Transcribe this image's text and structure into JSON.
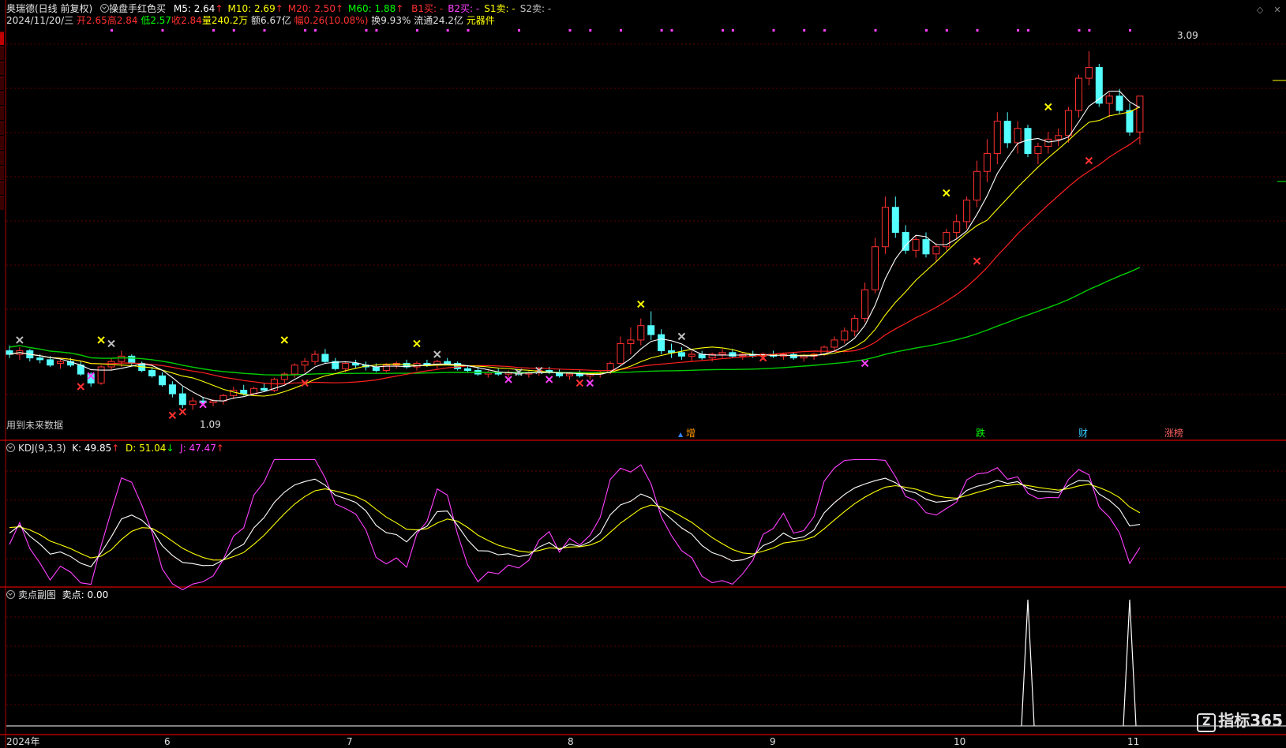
{
  "header": {
    "stock_name": "奥瑞德(日线 前复权)",
    "indicator_name": "操盘手红色买",
    "ma": [
      {
        "label": "M5:",
        "value": "2.64",
        "arrow": "↑",
        "color": "#ffffff"
      },
      {
        "label": "M10:",
        "value": "2.69",
        "arrow": "↑",
        "color": "#ffff00"
      },
      {
        "label": "M20:",
        "value": "2.50",
        "arrow": "↑",
        "color": "#ff3030"
      },
      {
        "label": "M60:",
        "value": "1.88",
        "arrow": "↑",
        "color": "#00ff00"
      }
    ],
    "signals": [
      {
        "label": "B1买:",
        "value": "-",
        "color": "#ff3030"
      },
      {
        "label": "B2买:",
        "value": "-",
        "color": "#ff40ff"
      },
      {
        "label": "S1卖:",
        "value": "-",
        "color": "#ffff00"
      },
      {
        "label": "S2卖:",
        "value": "-",
        "color": "#c0c0c0"
      }
    ],
    "date": "2024/11/20/三",
    "open": "开2.65",
    "high": "高2.84",
    "low": "低2.57",
    "close": "收2.84",
    "volume": "量240.2万",
    "amount": "额6.67亿",
    "change": "幅0.26(10.08%)",
    "turnover": "换9.93%",
    "float": "流通24.2亿",
    "sector": "元器件"
  },
  "main_panel": {
    "future_data_note": "用到未来数据",
    "high_label": "3.09",
    "low_label": "1.09",
    "events": [
      {
        "label": "增",
        "color": "#ff9900"
      },
      {
        "label": "跌",
        "color": "#00ff00"
      },
      {
        "label": "财",
        "color": "#33ccff"
      },
      {
        "label": "涨榜",
        "color": "#ff6060"
      }
    ]
  },
  "kdj_panel": {
    "title": "KDJ(9,3,3)",
    "k": "K: 49.85",
    "k_arrow": "↑",
    "d": "D: 51.04",
    "d_arrow": "↓",
    "j": "J: 47.47",
    "j_arrow": "↑"
  },
  "sell_panel": {
    "title": "卖点副图",
    "value": "卖点: 0.00"
  },
  "x_axis": {
    "labels": [
      "2024年",
      "6",
      "7",
      "8",
      "9",
      "10",
      "11"
    ]
  },
  "logo": {
    "text": "指标365",
    "mark": "Z"
  },
  "colors": {
    "up": "#ff3030",
    "down": "#54ffff",
    "ma5": "#ffffff",
    "ma10": "#ffff00",
    "ma20": "#ff2020",
    "ma60": "#00cc00",
    "grid": "#5a0000",
    "panel_border": "#b00000"
  },
  "chart_data": {
    "type": "candlestick",
    "candles": [
      [
        1.42,
        1.45,
        1.38,
        1.4
      ],
      [
        1.4,
        1.44,
        1.37,
        1.42
      ],
      [
        1.42,
        1.43,
        1.36,
        1.38
      ],
      [
        1.38,
        1.4,
        1.35,
        1.37
      ],
      [
        1.37,
        1.39,
        1.33,
        1.34
      ],
      [
        1.35,
        1.37,
        1.32,
        1.36
      ],
      [
        1.36,
        1.38,
        1.33,
        1.34
      ],
      [
        1.34,
        1.36,
        1.28,
        1.29
      ],
      [
        1.29,
        1.3,
        1.22,
        1.24
      ],
      [
        1.24,
        1.34,
        1.23,
        1.33
      ],
      [
        1.33,
        1.38,
        1.31,
        1.36
      ],
      [
        1.36,
        1.42,
        1.33,
        1.39
      ],
      [
        1.39,
        1.4,
        1.34,
        1.35
      ],
      [
        1.35,
        1.36,
        1.3,
        1.31
      ],
      [
        1.31,
        1.33,
        1.27,
        1.28
      ],
      [
        1.28,
        1.3,
        1.22,
        1.23
      ],
      [
        1.23,
        1.25,
        1.16,
        1.18
      ],
      [
        1.18,
        1.22,
        1.1,
        1.12
      ],
      [
        1.12,
        1.16,
        1.09,
        1.14
      ],
      [
        1.14,
        1.16,
        1.12,
        1.13
      ],
      [
        1.13,
        1.15,
        1.11,
        1.14
      ],
      [
        1.14,
        1.18,
        1.12,
        1.17
      ],
      [
        1.17,
        1.22,
        1.15,
        1.2
      ],
      [
        1.2,
        1.23,
        1.17,
        1.18
      ],
      [
        1.18,
        1.22,
        1.17,
        1.21
      ],
      [
        1.21,
        1.24,
        1.19,
        1.2
      ],
      [
        1.2,
        1.27,
        1.19,
        1.26
      ],
      [
        1.26,
        1.3,
        1.24,
        1.29
      ],
      [
        1.29,
        1.35,
        1.27,
        1.34
      ],
      [
        1.34,
        1.38,
        1.3,
        1.36
      ],
      [
        1.36,
        1.42,
        1.34,
        1.4
      ],
      [
        1.4,
        1.43,
        1.35,
        1.36
      ],
      [
        1.36,
        1.38,
        1.31,
        1.32
      ],
      [
        1.32,
        1.36,
        1.3,
        1.35
      ],
      [
        1.35,
        1.37,
        1.32,
        1.34
      ],
      [
        1.34,
        1.36,
        1.31,
        1.33
      ],
      [
        1.33,
        1.35,
        1.3,
        1.31
      ],
      [
        1.31,
        1.35,
        1.3,
        1.34
      ],
      [
        1.34,
        1.36,
        1.32,
        1.35
      ],
      [
        1.35,
        1.37,
        1.32,
        1.33
      ],
      [
        1.33,
        1.36,
        1.31,
        1.35
      ],
      [
        1.35,
        1.37,
        1.33,
        1.34
      ],
      [
        1.34,
        1.37,
        1.32,
        1.36
      ],
      [
        1.36,
        1.38,
        1.34,
        1.35
      ],
      [
        1.35,
        1.36,
        1.31,
        1.32
      ],
      [
        1.32,
        1.34,
        1.3,
        1.31
      ],
      [
        1.31,
        1.33,
        1.28,
        1.29
      ],
      [
        1.29,
        1.31,
        1.27,
        1.3
      ],
      [
        1.3,
        1.32,
        1.28,
        1.29
      ],
      [
        1.29,
        1.31,
        1.27,
        1.3
      ],
      [
        1.3,
        1.31,
        1.28,
        1.29
      ],
      [
        1.29,
        1.31,
        1.27,
        1.3
      ],
      [
        1.3,
        1.33,
        1.28,
        1.31
      ],
      [
        1.31,
        1.33,
        1.29,
        1.3
      ],
      [
        1.3,
        1.32,
        1.27,
        1.28
      ],
      [
        1.28,
        1.3,
        1.26,
        1.29
      ],
      [
        1.29,
        1.31,
        1.27,
        1.28
      ],
      [
        1.28,
        1.3,
        1.26,
        1.29
      ],
      [
        1.29,
        1.31,
        1.27,
        1.3
      ],
      [
        1.3,
        1.36,
        1.29,
        1.35
      ],
      [
        1.35,
        1.5,
        1.34,
        1.46
      ],
      [
        1.46,
        1.55,
        1.4,
        1.48
      ],
      [
        1.48,
        1.6,
        1.45,
        1.56
      ],
      [
        1.56,
        1.64,
        1.48,
        1.51
      ],
      [
        1.51,
        1.54,
        1.4,
        1.42
      ],
      [
        1.42,
        1.46,
        1.38,
        1.41
      ],
      [
        1.41,
        1.44,
        1.37,
        1.39
      ],
      [
        1.39,
        1.42,
        1.36,
        1.4
      ],
      [
        1.4,
        1.42,
        1.37,
        1.38
      ],
      [
        1.38,
        1.41,
        1.36,
        1.4
      ],
      [
        1.4,
        1.43,
        1.38,
        1.41
      ],
      [
        1.41,
        1.43,
        1.38,
        1.39
      ],
      [
        1.39,
        1.41,
        1.37,
        1.4
      ],
      [
        1.4,
        1.42,
        1.38,
        1.39
      ],
      [
        1.39,
        1.41,
        1.37,
        1.4
      ],
      [
        1.4,
        1.42,
        1.38,
        1.39
      ],
      [
        1.39,
        1.41,
        1.37,
        1.4
      ],
      [
        1.4,
        1.41,
        1.37,
        1.38
      ],
      [
        1.38,
        1.4,
        1.36,
        1.39
      ],
      [
        1.39,
        1.41,
        1.37,
        1.4
      ],
      [
        1.4,
        1.45,
        1.39,
        1.44
      ],
      [
        1.44,
        1.5,
        1.42,
        1.48
      ],
      [
        1.48,
        1.55,
        1.46,
        1.53
      ],
      [
        1.53,
        1.62,
        1.5,
        1.6
      ],
      [
        1.6,
        1.8,
        1.58,
        1.76
      ],
      [
        1.76,
        2.05,
        1.74,
        2.0
      ],
      [
        2.0,
        2.28,
        1.96,
        2.22
      ],
      [
        2.22,
        2.28,
        2.05,
        2.08
      ],
      [
        2.08,
        2.12,
        1.96,
        1.98
      ],
      [
        1.98,
        2.06,
        1.94,
        2.04
      ],
      [
        2.04,
        2.08,
        1.94,
        1.96
      ],
      [
        1.96,
        2.02,
        1.92,
        2.0
      ],
      [
        2.0,
        2.1,
        1.98,
        2.08
      ],
      [
        2.08,
        2.18,
        2.04,
        2.14
      ],
      [
        2.14,
        2.28,
        2.1,
        2.26
      ],
      [
        2.26,
        2.48,
        2.22,
        2.42
      ],
      [
        2.42,
        2.6,
        2.36,
        2.52
      ],
      [
        2.52,
        2.75,
        2.46,
        2.7
      ],
      [
        2.7,
        2.75,
        2.55,
        2.58
      ],
      [
        2.58,
        2.7,
        2.52,
        2.66
      ],
      [
        2.66,
        2.68,
        2.5,
        2.52
      ],
      [
        2.52,
        2.58,
        2.46,
        2.56
      ],
      [
        2.56,
        2.64,
        2.52,
        2.6
      ],
      [
        2.6,
        2.66,
        2.56,
        2.62
      ],
      [
        2.62,
        2.78,
        2.58,
        2.76
      ],
      [
        2.76,
        2.96,
        2.72,
        2.94
      ],
      [
        2.94,
        3.09,
        2.9,
        3.0
      ],
      [
        3.0,
        3.02,
        2.78,
        2.8
      ],
      [
        2.8,
        2.86,
        2.72,
        2.84
      ],
      [
        2.84,
        2.88,
        2.74,
        2.76
      ],
      [
        2.76,
        2.8,
        2.62,
        2.64
      ],
      [
        2.64,
        2.84,
        2.57,
        2.84
      ]
    ]
  }
}
